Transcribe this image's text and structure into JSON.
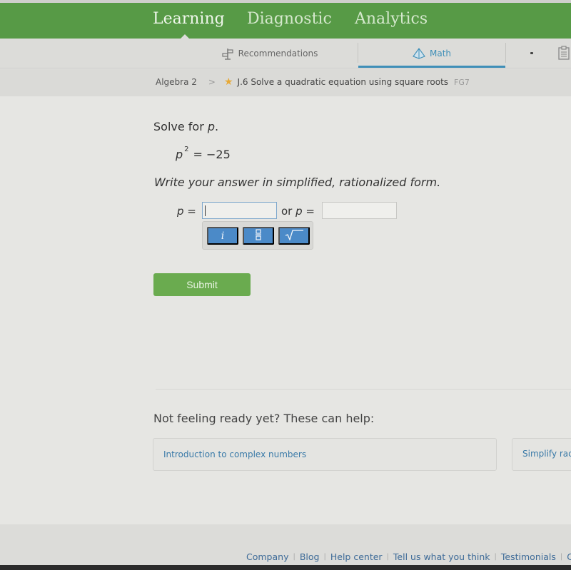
{
  "topnav": {
    "items": [
      {
        "label": "Learning",
        "active": true
      },
      {
        "label": "Diagnostic",
        "active": false
      },
      {
        "label": "Analytics",
        "active": false
      }
    ],
    "color": "#579a46"
  },
  "subnav": {
    "tabs": [
      {
        "label": "Recommendations",
        "icon": "signpost-icon",
        "active": false
      },
      {
        "label": "Math",
        "icon": "pyramid-icon",
        "active": true
      }
    ],
    "accent": "#3f8fb8"
  },
  "breadcrumb": {
    "parent": "Algebra 2",
    "separator": ">",
    "skill": "J.6 Solve a quadratic equation using square roots",
    "code": "FG7"
  },
  "question": {
    "prompt_prefix": "Solve for ",
    "prompt_var": "p",
    "prompt_suffix": ".",
    "equation": {
      "var": "p",
      "exponent": "2",
      "rhs": "= −25"
    },
    "instruction": "Write your answer in simplified, rationalized form.",
    "answer1_label_var": "p",
    "answer1_label_eq": " =",
    "answer1_value": "",
    "answer2_label_or": "or ",
    "answer2_label_var": "p",
    "answer2_label_eq": " =",
    "answer2_value": ""
  },
  "keypad": {
    "keys": [
      {
        "label": "i",
        "name": "imaginary-unit"
      },
      {
        "label": "fraction",
        "name": "fraction"
      },
      {
        "label": "√",
        "name": "square-root"
      }
    ],
    "color": "#4b8ac8"
  },
  "submit": {
    "label": "Submit",
    "color": "#6aab4f"
  },
  "help": {
    "title": "Not feeling ready yet? These can help:",
    "cards": [
      {
        "label": "Introduction to complex numbers"
      },
      {
        "label": "Simplify rac"
      }
    ]
  },
  "footer": {
    "links": [
      "Company",
      "Blog",
      "Help center",
      "Tell us what you think",
      "Testimonials",
      "Cor"
    ]
  }
}
